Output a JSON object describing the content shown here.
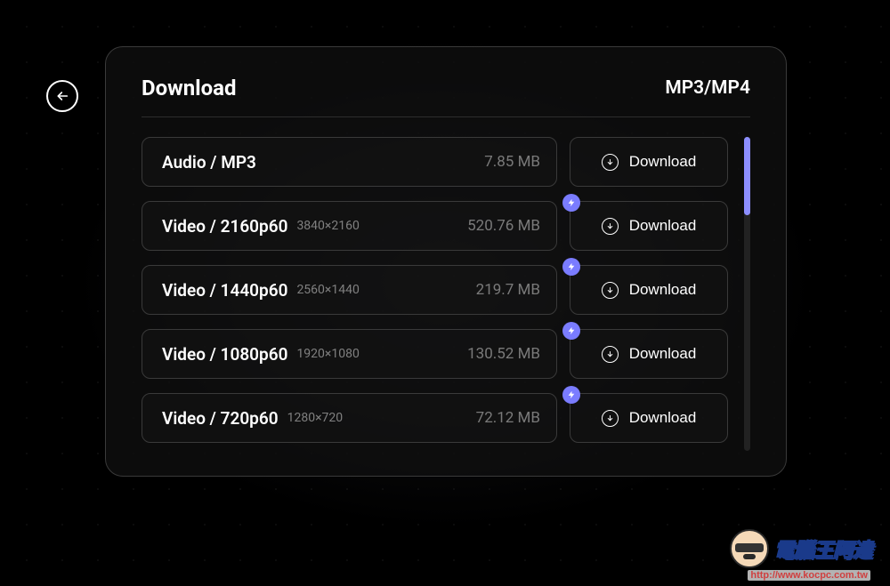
{
  "header": {
    "title": "Download",
    "format_label": "MP3/MP4"
  },
  "download_btn_label": "Download",
  "items": [
    {
      "label": "Audio / MP3",
      "resolution": "",
      "size": "7.85 MB",
      "badge": false
    },
    {
      "label": "Video / 2160p60",
      "resolution": "3840×2160",
      "size": "520.76 MB",
      "badge": true
    },
    {
      "label": "Video / 1440p60",
      "resolution": "2560×1440",
      "size": "219.7 MB",
      "badge": true
    },
    {
      "label": "Video / 1080p60",
      "resolution": "1920×1080",
      "size": "130.52 MB",
      "badge": true
    },
    {
      "label": "Video / 720p60",
      "resolution": "1280×720",
      "size": "72.12 MB",
      "badge": true
    }
  ],
  "watermark": {
    "text": "電腦王阿達",
    "url": "http://www.kocpc.com.tw"
  }
}
